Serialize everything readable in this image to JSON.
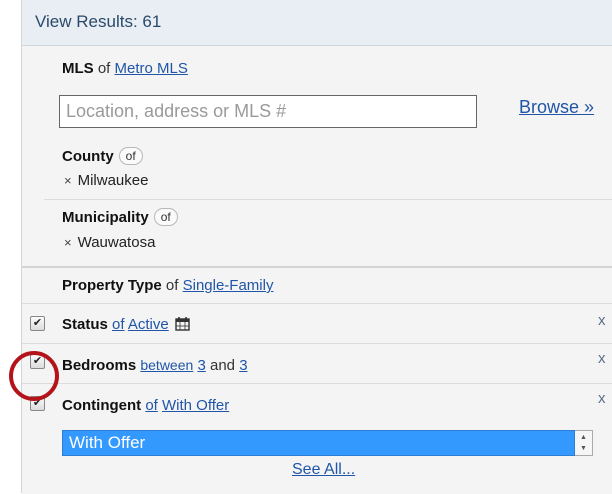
{
  "header": {
    "view_results": "View Results: 61"
  },
  "mls": {
    "label": "MLS",
    "of": "of",
    "source": "Metro MLS"
  },
  "search": {
    "placeholder": "Location, address or MLS #",
    "value": "",
    "browse": "Browse »"
  },
  "county": {
    "label": "County",
    "of_pill": "of",
    "chip": "Milwaukee"
  },
  "municipality": {
    "label": "Municipality",
    "of_pill": "of",
    "chip": "Wauwatosa"
  },
  "property_type": {
    "label": "Property Type",
    "of": "of",
    "value": "Single-Family"
  },
  "status": {
    "label": "Status",
    "of": "of",
    "value": "Active",
    "remove": "x",
    "checked": true
  },
  "bedrooms": {
    "label": "Bedrooms",
    "between": "between",
    "min": "3",
    "and": "and",
    "max": "3",
    "remove": "x",
    "checked": true
  },
  "contingent": {
    "label": "Contingent",
    "of": "of",
    "value": "With Offer",
    "remove": "x",
    "checked": true
  },
  "contingent_select": {
    "selected": "With Offer",
    "see_all": "See All..."
  },
  "chip_remove": "×",
  "check_mark": "✔",
  "colors": {
    "accent_blue": "#3399ff",
    "link": "#2055a8",
    "highlight_circle": "#b3141a"
  }
}
